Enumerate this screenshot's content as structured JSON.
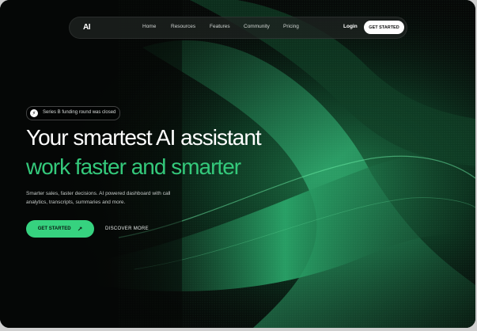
{
  "nav": {
    "logo": "AI",
    "links": [
      "Home",
      "Resources",
      "Features",
      "Community",
      "Pricing"
    ],
    "login": "Login",
    "cta": "GET STARTED"
  },
  "hero": {
    "badge_icon": "lightning-icon",
    "badge_text": "Series B funding round was closed",
    "title_line1": "Your smartest AI assistant",
    "title_line2": "work faster and smarter",
    "description": "Smarter sales, faster decisions. AI powered dashboard with call analytics, transcripts, summaries and more.",
    "primary_cta": "GET STARTED",
    "primary_cta_icon": "arrow-up-right-icon",
    "secondary_cta": "DISCOVER MORE"
  },
  "colors": {
    "accent": "#36d27f",
    "headline_green": "#34c97b",
    "background": "#070908"
  }
}
